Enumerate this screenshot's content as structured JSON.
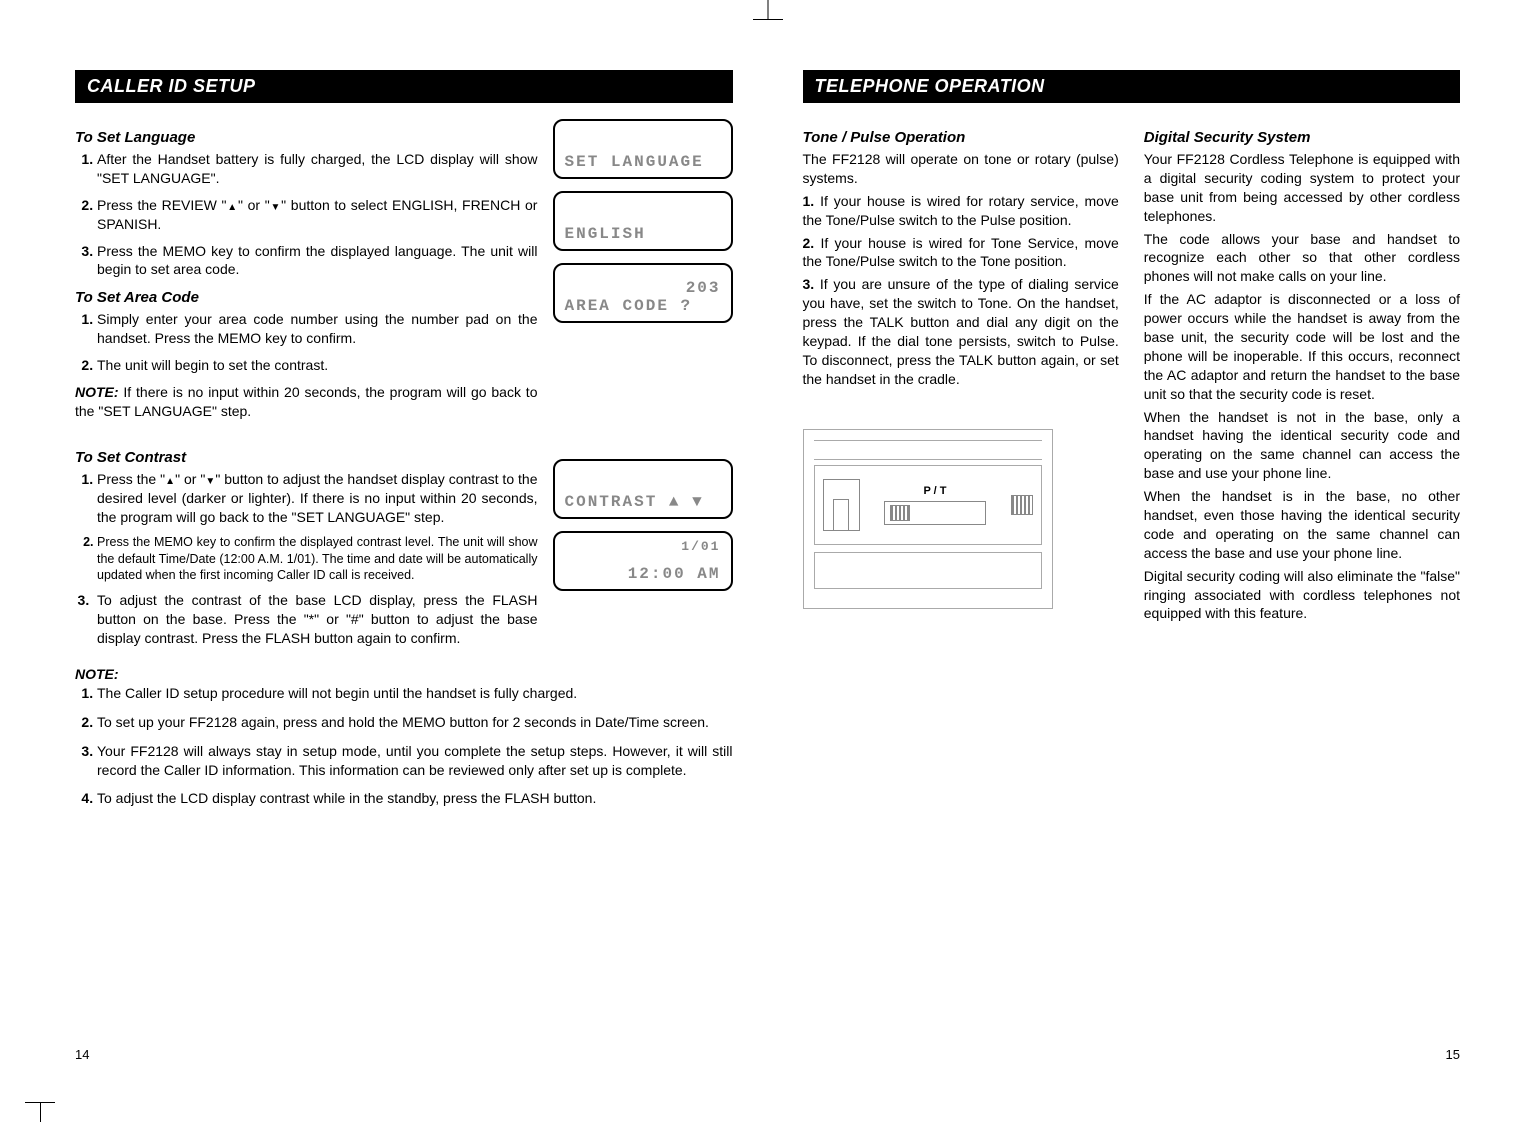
{
  "left": {
    "header": "CALLER ID SETUP",
    "lang": {
      "heading": "To Set Language",
      "s1": "After the Handset battery is fully charged, the LCD display will show \"SET LANGUAGE\".",
      "s2a": "Press the REVIEW \"",
      "s2b": "\" or \"",
      "s2c": "\" button to select ENGLISH, FRENCH or SPANISH.",
      "s3": "Press the MEMO key to confirm the displayed language. The unit will begin to set area code."
    },
    "area": {
      "heading": "To Set Area Code",
      "s1": "Simply enter your area code number using the number pad on the handset. Press the MEMO key to confirm.",
      "s2": "The unit will begin to set the contrast."
    },
    "note_inline_a": "NOTE:",
    "note_inline_b": " If there is no input within 20 seconds, the program will go back to the \"SET LANGUAGE\" step.",
    "contrast": {
      "heading": "To Set Contrast",
      "s1a": "Press the \"",
      "s1b": "\" or \"",
      "s1c": "\" button to adjust the handset display contrast to the desired level (darker or lighter). If there is no input within 20 seconds, the program will go back to the \"SET LANGUAGE\" step.",
      "s2": "Press the MEMO key to confirm the displayed contrast level. The unit will show the default Time/Date (12:00 A.M. 1/01). The time and date will be automatically updated when the first incoming Caller ID call is received.",
      "s3": "To adjust the contrast of the base LCD display, press the FLASH button on the base. Press the \"*\" or \"#\" button to adjust the base display contrast. Press the FLASH button again to confirm."
    },
    "notes": {
      "label": "NOTE:",
      "n1": "The Caller ID setup procedure will not begin until the handset is fully charged.",
      "n2": "To set up your FF2128 again, press and hold the MEMO button for 2 seconds in Date/Time screen.",
      "n3": "Your FF2128 will always stay in setup mode, until you complete the setup steps. However, it will still record the Caller ID information. This information can be reviewed only after set up is complete.",
      "n4": "To adjust the LCD display contrast while in the standby, press the FLASH button."
    },
    "lcd": {
      "set_language": "SET LANGUAGE",
      "english": "ENGLISH",
      "area_num": "203",
      "area_code": "AREA CODE ?",
      "contrast": "CONTRAST ▲ ▼",
      "date": "1/01",
      "time": "12:00 AM"
    },
    "page_num": "14"
  },
  "right": {
    "header": "TELEPHONE OPERATION",
    "tone": {
      "heading": "Tone / Pulse Operation",
      "intro": "The FF2128 will operate on tone or rotary (pulse) systems.",
      "s1": "If your house is wired for rotary service, move the Tone/Pulse switch to the Pulse position.",
      "s2": "If your house is wired for Tone Service, move the Tone/Pulse switch to the Tone position.",
      "s3": "If you are unsure of the type of dialing service you have, set the switch to Tone. On the handset, press the TALK button and dial any digit on the keypad. If the dial tone persists, switch to Pulse. To disconnect, press the TALK button again, or set the handset in the cradle."
    },
    "switch_label": "P / T",
    "security": {
      "heading": "Digital Security System",
      "p1": "Your FF2128 Cordless Telephone is equipped with a digital security coding system to protect your base unit from being accessed by other cordless telephones.",
      "p2": "The code allows your base and handset to recognize each other so that other cordless phones will not make calls on your line.",
      "p3": "If the AC adaptor is disconnected or a loss of power occurs while the handset is away from the base unit, the security code will be lost and the phone will be inoperable. If this occurs, reconnect the AC adaptor and return the handset to the base unit so that the security code is reset.",
      "p4": "When the handset is not in the base, only a handset having the identical security code and operating on the same channel can access the base and use your phone line.",
      "p5": "When the handset is in the base, no other handset, even those having the identical security code and operating on the same channel can access the base and use your phone line.",
      "p6": "Digital security coding will also eliminate the \"false\" ringing associated with cordless telephones not equipped with this feature."
    },
    "page_num": "15"
  }
}
